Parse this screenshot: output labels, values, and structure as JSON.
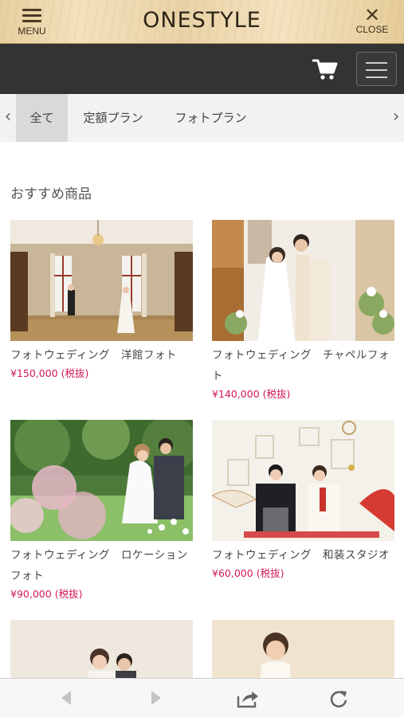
{
  "header": {
    "menu_label": "MENU",
    "brand": "ONESTYLE",
    "close_label": "CLOSE"
  },
  "toolbar": {
    "cart_icon": "cart-icon",
    "hamburger_icon": "hamburger-icon"
  },
  "tabs": {
    "items": [
      "全て",
      "定額プラン",
      "フォトプラン"
    ],
    "active": "全て"
  },
  "section": {
    "title": "おすすめ商品"
  },
  "products": [
    {
      "title": "フォトウェディング　洋館フォト",
      "price": "¥150,000",
      "tax": "(税抜)"
    },
    {
      "title": "フォトウェディング　チャペルフォト",
      "price": "¥140,000",
      "tax": "(税抜)"
    },
    {
      "title": "フォトウェディング　ロケーションフォト",
      "price": "¥90,000",
      "tax": "(税抜)"
    },
    {
      "title": "フォトウェディング　和装スタジオ",
      "price": "¥60,000",
      "tax": "(税抜)"
    }
  ],
  "browser_bar": {
    "icons": [
      "back-icon",
      "forward-icon",
      "share-icon",
      "reload-icon"
    ]
  },
  "colors": {
    "price": "#d0175c",
    "dark_bar": "#333333",
    "tab_active": "#d9d9d9"
  }
}
